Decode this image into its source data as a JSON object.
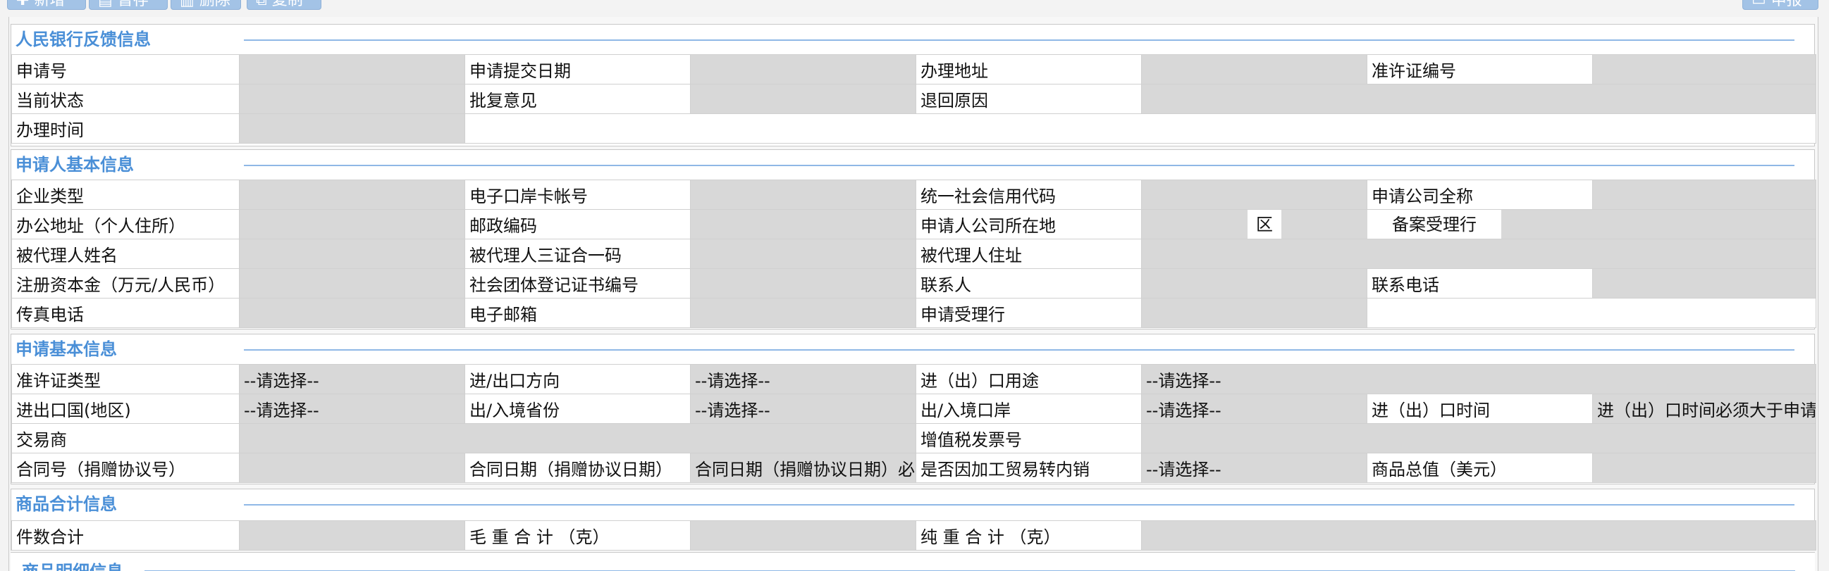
{
  "toolbar": {
    "add_label": "新增",
    "save_label": "暂存",
    "delete_label": "删除",
    "copy_label": "复制",
    "report_label": "申报"
  },
  "bank_feedback": {
    "title": "人民银行反馈信息",
    "labels": {
      "application_no": "申请号",
      "submit_date": "申请提交日期",
      "handling_address": "办理地址",
      "permit_no": "准许证编号",
      "current_status": "当前状态",
      "approval_opinion": "批复意见",
      "return_reason": "退回原因",
      "handling_time": "办理时间"
    }
  },
  "applicant": {
    "title": "申请人基本信息",
    "labels": {
      "enterprise_type": "企业类型",
      "eport_card_no": "电子口岸卡帐号",
      "credit_code": "统一社会信用代码",
      "company_full_name": "申请公司全称",
      "office_address": "办公地址（个人住所）",
      "postal_code": "邮政编码",
      "company_location": "申请人公司所在地",
      "district": "区",
      "record_bank": "备案受理行",
      "agent_name": "被代理人姓名",
      "agent_license": "被代理人三证合一码",
      "agent_address": "被代理人住址",
      "registered_capital": "注册资本金（万元/人民币）",
      "social_org_cert": "社会团体登记证书编号",
      "contact_person": "联系人",
      "contact_phone": "联系电话",
      "fax": "传真电话",
      "email": "电子邮箱",
      "accepting_bank": "申请受理行"
    }
  },
  "application": {
    "title": "申请基本信息",
    "select_placeholder": "--请选择--",
    "labels": {
      "permit_type": "准许证类型",
      "direction": "进/出口方向",
      "purpose": "进（出）口用途",
      "country": "进出口国(地区)",
      "province": "出/入境省份",
      "port": "出/入境口岸",
      "io_time": "进（出）口时间",
      "trader": "交易商",
      "vat_invoice": "增值税发票号",
      "contract_no": "合同号（捐赠协议号）",
      "contract_date": "合同日期（捐赠协议日期）",
      "processing_trade": "是否因加工贸易转内销",
      "total_value": "商品总值（美元）"
    },
    "io_time_placeholder": "进（出）口时间必须大于申请提交日期",
    "contract_date_placeholder": "合同日期（捐赠协议日期）必须小于申请提交日期"
  },
  "goods_total": {
    "title": "商品合计信息",
    "labels": {
      "piece_count": "件数合计",
      "gross_weight": "毛 重 合 计 （克）",
      "net_weight": "纯 重 合 计 （克）"
    }
  },
  "goods_detail": {
    "title": "商品明细信息"
  }
}
